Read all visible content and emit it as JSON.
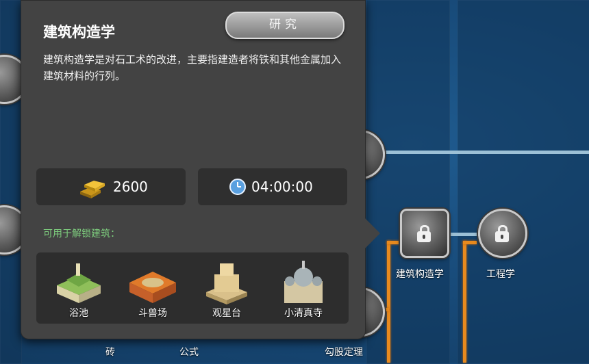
{
  "tooltip": {
    "title": "建筑构造学",
    "research_button": "研究",
    "description": "建筑构造学是对石工术的改进，主要指建造者将铁和其他金属加入建筑材料的行列。",
    "cost": "2600",
    "time": "04:00:00",
    "unlock_label": "可用于解锁建筑：",
    "buildings": [
      {
        "label": "浴池",
        "icon": "bath-building-icon"
      },
      {
        "label": "斗兽场",
        "icon": "colosseum-building-icon"
      },
      {
        "label": "观星台",
        "icon": "observatory-building-icon"
      },
      {
        "label": "小清真寺",
        "icon": "mosque-building-icon"
      }
    ]
  },
  "tree_nodes": {
    "construction": "建筑构造学",
    "engineering": "工程学"
  },
  "bottom_labels": {
    "brick": "砖",
    "formula": "公式",
    "pythagoras": "勾股定理"
  },
  "colors": {
    "panel": "#434343",
    "accent_green": "#7fd07f",
    "connector_orange": "#e88a1e"
  }
}
